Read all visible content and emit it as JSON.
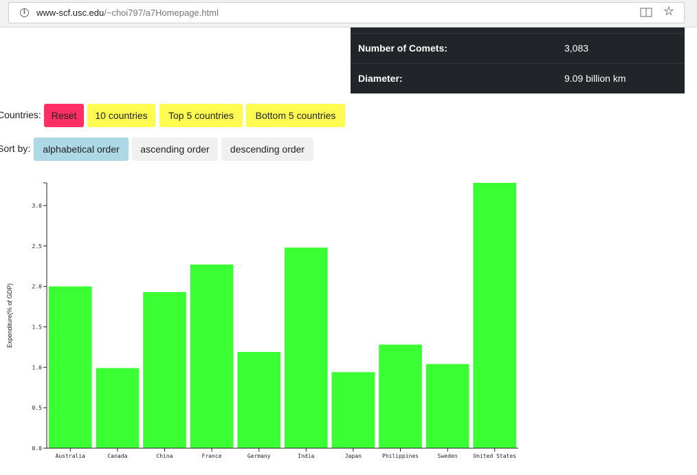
{
  "browser": {
    "url_host": "www-scf.usc.edu",
    "url_path": "/~choi797/a7Homepage.html"
  },
  "stats": [
    {
      "label": "Number of Comets:",
      "value": "3,083"
    },
    {
      "label": "Diameter:",
      "value": "9.09 billion km"
    }
  ],
  "countries_filter": {
    "label": "Countries:",
    "buttons": [
      "Reset",
      "10 countries",
      "Top 5 countries",
      "Bottom 5 countries"
    ]
  },
  "sort_controls": {
    "label": "Sort by:",
    "buttons": [
      "alphabetical order",
      "ascending order",
      "descending order"
    ],
    "active": "alphabetical order"
  },
  "colors": {
    "bar": "#39ff33",
    "reset": "#ff2e63",
    "filter": "#fffb50",
    "sort_active": "#add8e6",
    "sort_inactive": "#f0f0f0",
    "stats_bg": "#212529"
  },
  "chart_data": {
    "type": "bar",
    "categories": [
      "Australia",
      "Canada",
      "China",
      "France",
      "Germany",
      "India",
      "Japan",
      "Philippines",
      "Sweden",
      "United States"
    ],
    "values": [
      2.0,
      0.99,
      1.93,
      2.27,
      1.19,
      2.48,
      0.94,
      1.28,
      1.04,
      3.28
    ],
    "ylabel": "Expenditure(% of GDP)",
    "xlabel": "",
    "yticks": [
      "0.0",
      "0.5",
      "1.0",
      "1.5",
      "2.0",
      "2.5",
      "3.0"
    ],
    "ylim": [
      0,
      3.28
    ],
    "grid": false
  }
}
